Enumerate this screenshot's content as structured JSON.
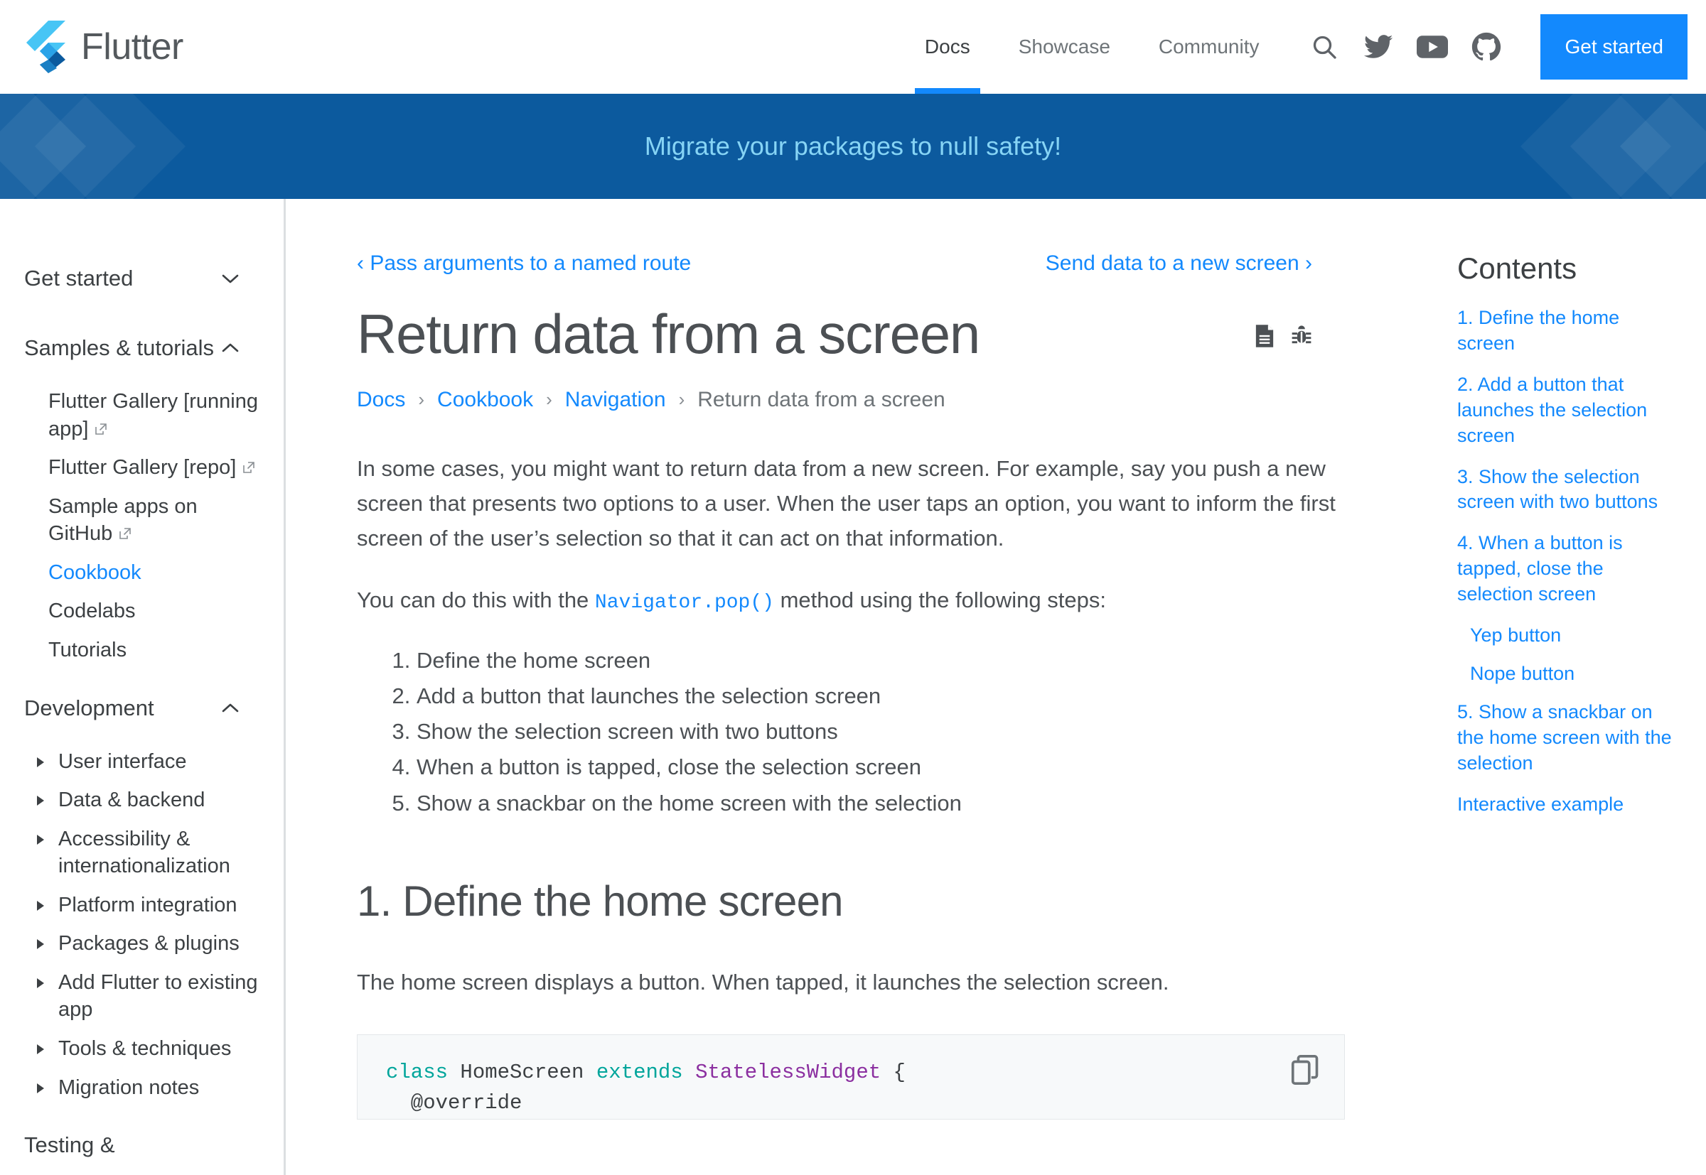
{
  "header": {
    "logo_text": "Flutter",
    "nav": [
      {
        "label": "Docs",
        "active": true
      },
      {
        "label": "Showcase",
        "active": false
      },
      {
        "label": "Community",
        "active": false
      }
    ],
    "icons": [
      "search-icon",
      "twitter-icon",
      "youtube-icon",
      "github-icon"
    ],
    "cta_label": "Get started"
  },
  "banner": {
    "text": "Migrate your packages to null safety!"
  },
  "sidebar": {
    "sections": [
      {
        "label": "Get started",
        "state": "collapsed"
      },
      {
        "label": "Samples & tutorials",
        "state": "expanded"
      },
      {
        "label": "Development",
        "state": "expanded"
      },
      {
        "label": "Testing &",
        "state": "partial"
      }
    ],
    "samples_items": [
      {
        "label": "Flutter Gallery [running app]",
        "external": true,
        "active": false
      },
      {
        "label": "Flutter Gallery [repo]",
        "external": true,
        "active": false
      },
      {
        "label": "Sample apps on GitHub",
        "external": true,
        "active": false
      },
      {
        "label": "Cookbook",
        "external": false,
        "active": true
      },
      {
        "label": "Codelabs",
        "external": false,
        "active": false
      },
      {
        "label": "Tutorials",
        "external": false,
        "active": false
      }
    ],
    "development_items": [
      {
        "label": "User interface"
      },
      {
        "label": "Data & backend"
      },
      {
        "label": "Accessibility & internationalization"
      },
      {
        "label": "Platform integration"
      },
      {
        "label": "Packages & plugins"
      },
      {
        "label": "Add Flutter to existing app"
      },
      {
        "label": "Tools & techniques"
      },
      {
        "label": "Migration notes"
      }
    ]
  },
  "main": {
    "prev_link": "‹ Pass arguments to a named route",
    "next_link": "Send data to a new screen ›",
    "title": "Return data from a screen",
    "title_icons": [
      "page-source-icon",
      "bug-report-icon"
    ],
    "breadcrumb": [
      {
        "label": "Docs",
        "current": false
      },
      {
        "label": "Cookbook",
        "current": false
      },
      {
        "label": "Navigation",
        "current": false
      },
      {
        "label": "Return data from a screen",
        "current": true
      }
    ],
    "breadcrumb_sep": "›",
    "intro_paragraph": "In some cases, you might want to return data from a new screen. For example, say you push a new screen that presents two options to a user. When the user taps an option, you want to inform the first screen of the user’s selection so that it can act on that information.",
    "steps_lead_before": "You can do this with the ",
    "steps_lead_code": "Navigator.pop()",
    "steps_lead_after": " method using the following steps:",
    "steps": [
      "Define the home screen",
      "Add a button that launches the selection screen",
      "Show the selection screen with two buttons",
      "When a button is tapped, close the selection screen",
      "Show a snackbar on the home screen with the selection"
    ],
    "section_heading": "1. Define the home screen",
    "section_paragraph": "The home screen displays a button. When tapped, it launches the selection screen.",
    "code": {
      "line1_kw1": "class",
      "line1_name": " HomeScreen ",
      "line1_kw2": "extends",
      "line1_type": " StatelessWidget",
      "line1_brace": " {",
      "line2": "  @override",
      "copy_label": "copy-icon"
    }
  },
  "toc": {
    "title": "Contents",
    "items": [
      {
        "label": "1. Define the home screen",
        "sub": false
      },
      {
        "label": "2. Add a button that launches the selection screen",
        "sub": false
      },
      {
        "label": "3. Show the selection screen with two buttons",
        "sub": false
      },
      {
        "label": "4. When a button is tapped, close the selection screen",
        "sub": false
      },
      {
        "label": "Yep button",
        "sub": true
      },
      {
        "label": "Nope button",
        "sub": true
      },
      {
        "label": "5. Show a snackbar on the home screen with the selection",
        "sub": false
      },
      {
        "label": "Interactive example",
        "sub": false
      }
    ]
  },
  "colors": {
    "accent_blue": "#1389fd",
    "banner_bg": "#0c5a9e",
    "banner_text": "#86d4f5",
    "text_primary": "#4c5054",
    "icon_gray": "#5f6368"
  }
}
